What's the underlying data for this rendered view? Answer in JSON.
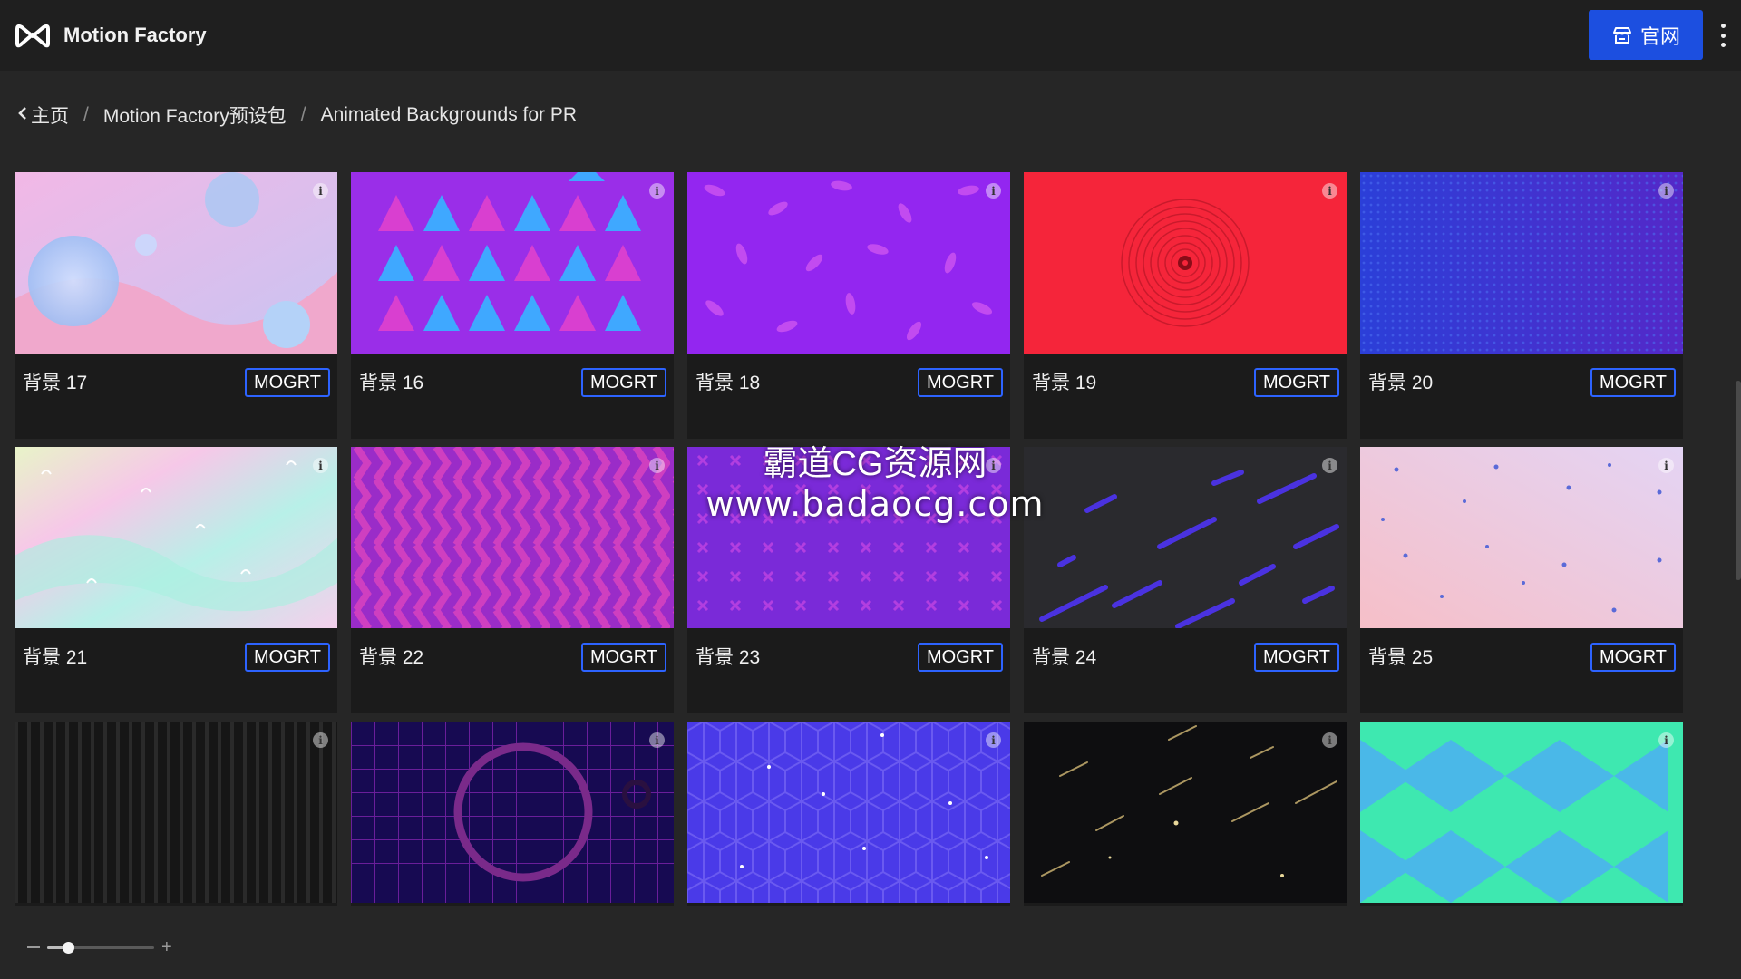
{
  "app": {
    "name": "Motion Factory"
  },
  "header": {
    "site_button_label": "官网"
  },
  "breadcrumb": {
    "items": [
      "主页",
      "Motion Factory预设包",
      "Animated Backgrounds for PR"
    ],
    "separator": "/"
  },
  "grid": {
    "button_label": "MOGRT",
    "info_glyph": "i",
    "cards": [
      {
        "title": "背景 17",
        "thumb": "pastel-bubbles"
      },
      {
        "title": "背景 16",
        "thumb": "triangles"
      },
      {
        "title": "背景 18",
        "thumb": "purple-ovals"
      },
      {
        "title": "背景 19",
        "thumb": "red-rings"
      },
      {
        "title": "背景 20",
        "thumb": "blue-halftone"
      },
      {
        "title": "背景 21",
        "thumb": "holographic"
      },
      {
        "title": "背景 22",
        "thumb": "zigzag"
      },
      {
        "title": "背景 23",
        "thumb": "x-pattern"
      },
      {
        "title": "背景 24",
        "thumb": "dark-streaks"
      },
      {
        "title": "背景 25",
        "thumb": "pink-dots"
      },
      {
        "title": "",
        "thumb": "dark-stripes"
      },
      {
        "title": "",
        "thumb": "neon-grid"
      },
      {
        "title": "",
        "thumb": "geo-lines"
      },
      {
        "title": "",
        "thumb": "starfield"
      },
      {
        "title": "",
        "thumb": "teal-triangles"
      }
    ]
  },
  "watermark": {
    "line1": "霸道CG资源网",
    "line2": "www.badaocg.com"
  },
  "zoom_slider": {
    "level": 0.2
  },
  "colors": {
    "accent": "#1c4fe0",
    "button_border": "#2d63ff",
    "background": "#262626"
  }
}
